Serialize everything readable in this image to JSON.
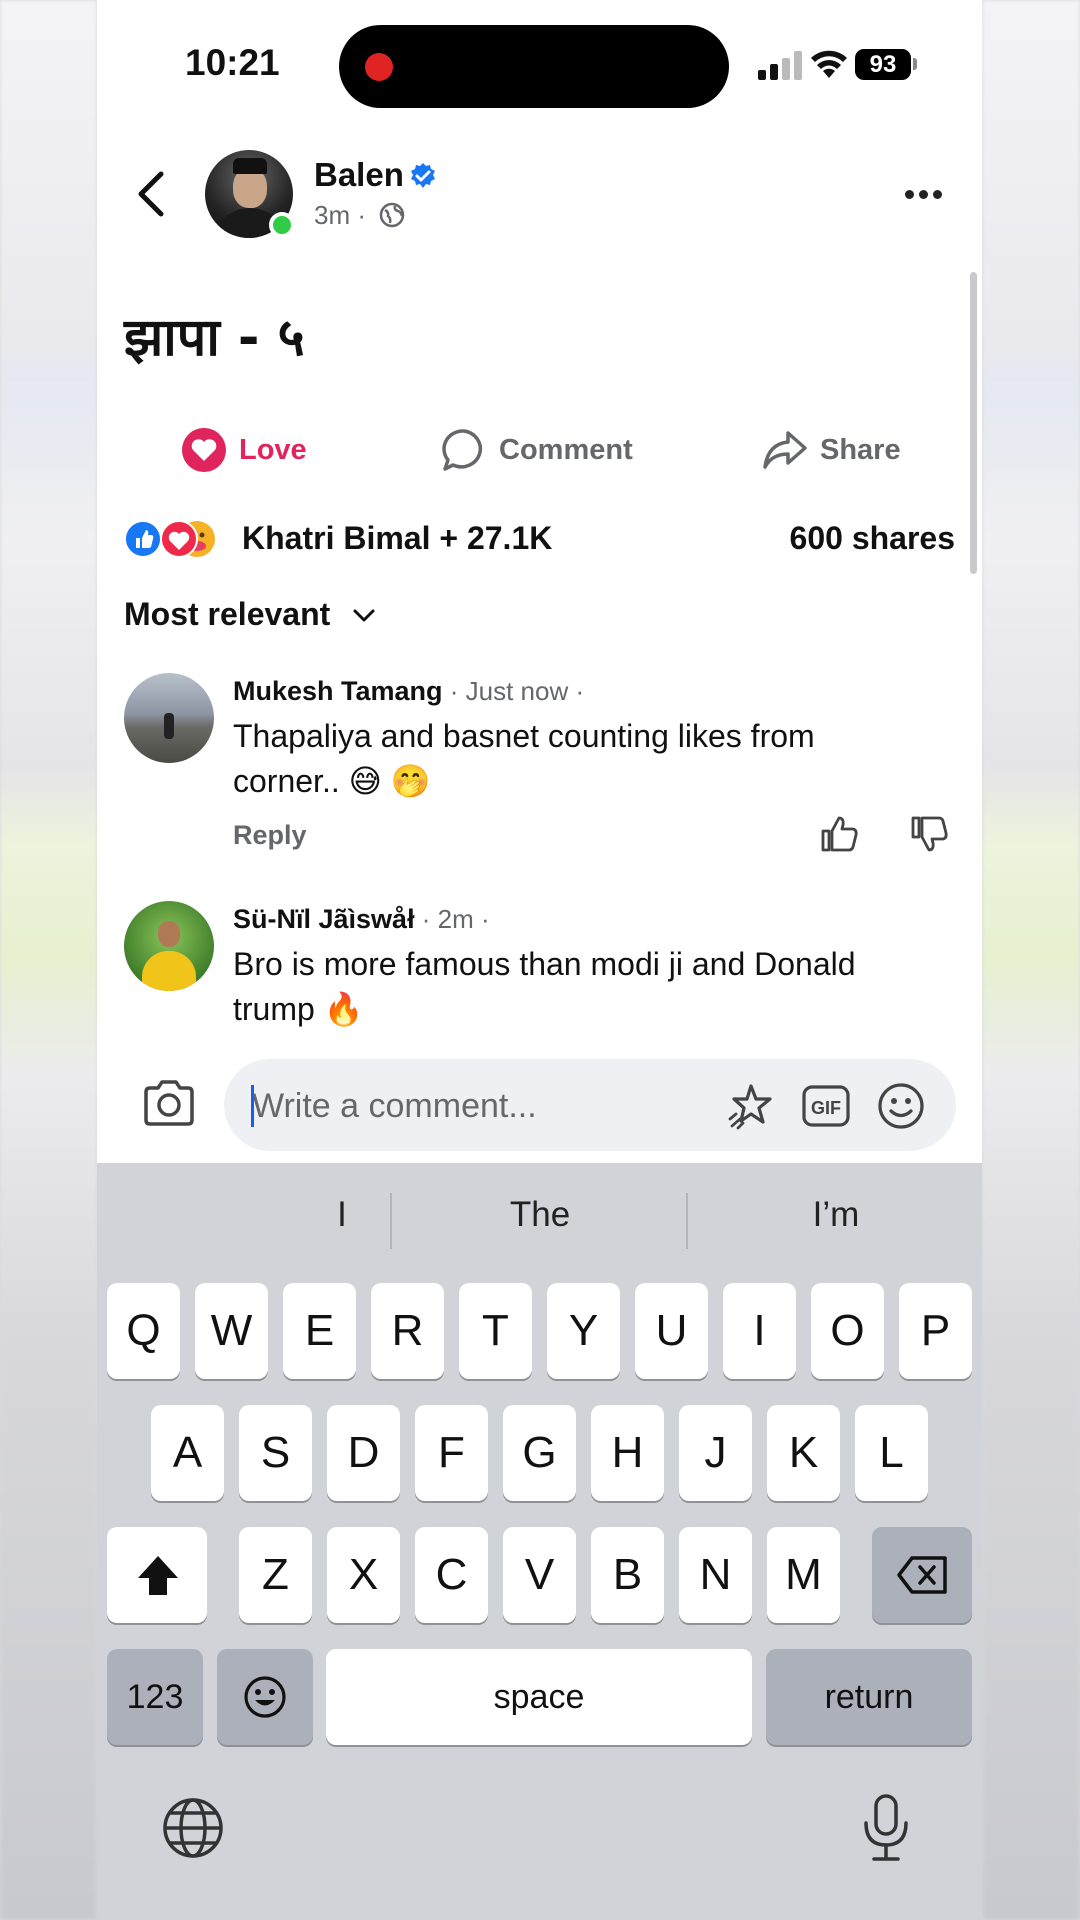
{
  "status_bar": {
    "time": "10:21",
    "battery": "93"
  },
  "post": {
    "author": "Balen",
    "meta_time": "3m ·",
    "text": "झापा - ५"
  },
  "actions": {
    "love": "Love",
    "comment": "Comment",
    "share": "Share"
  },
  "stats": {
    "reactions": "Khatri Bimal + 27.1K",
    "shares": "600 shares"
  },
  "sort": {
    "label": "Most relevant"
  },
  "comments": [
    {
      "name": "Mukesh Tamang",
      "time": " · Just now ·",
      "text": "Thapaliya  and basnet counting likes from corner.. 😅 🤭",
      "reply": "Reply"
    },
    {
      "name": "Sü-Nïl Jãìswåł",
      "time": " · 2m ·",
      "text": "Bro is more famous than modi ji and Donald trump 🔥"
    }
  ],
  "composer": {
    "placeholder": "Write a comment..."
  },
  "keyboard": {
    "suggestions": [
      "I",
      "The",
      "I’m"
    ],
    "row1": [
      "Q",
      "W",
      "E",
      "R",
      "T",
      "Y",
      "U",
      "I",
      "O",
      "P"
    ],
    "row2": [
      "A",
      "S",
      "D",
      "F",
      "G",
      "H",
      "J",
      "K",
      "L"
    ],
    "row3": [
      "Z",
      "X",
      "C",
      "V",
      "B",
      "N",
      "M"
    ],
    "numbers_key": "123",
    "space_key": "space",
    "return_key": "return"
  },
  "icons": {
    "back": "chevron-left-icon",
    "verified": "verified-badge-icon",
    "audience": "globe-icon",
    "more": "more-horizontal-icon",
    "love": "heart-icon",
    "comment": "comment-bubble-icon",
    "share": "share-arrow-icon",
    "camera": "camera-icon",
    "sticker": "sticker-star-icon",
    "gif": "gif-icon",
    "emoji": "smiley-icon",
    "like": "thumbs-up-icon",
    "dislike": "thumbs-down-icon",
    "shift": "shift-arrow-icon",
    "backspace": "backspace-icon",
    "keyboard_globe": "globe-icon",
    "mic": "microphone-icon"
  },
  "colors": {
    "love": "#e0245e",
    "verified": "#1877f2",
    "online": "#31cc46",
    "like_blue": "#1877f2"
  }
}
